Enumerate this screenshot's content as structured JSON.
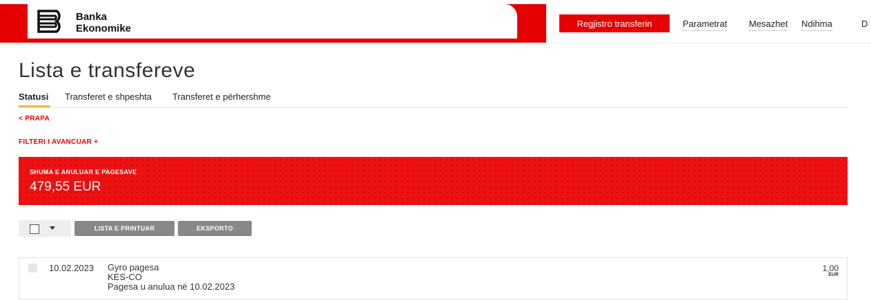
{
  "brand": {
    "line1": "Banka",
    "line2": "Ekonomike",
    "accent": "#e60000"
  },
  "header": {
    "register_label": "Regjistro transferin",
    "nav": [
      "Parametrat",
      "Mesazhet",
      "Ndihma",
      "D"
    ]
  },
  "page": {
    "title": "Lista e transfereve",
    "tabs": [
      "Statusi",
      "Transferet e shpeshta",
      "Transferet e përhershme"
    ],
    "active_tab": "Statusi",
    "back_label": "< PRAPA",
    "filter_label": "FILTERI I AVANCUAR +"
  },
  "summary": {
    "label": "SHUMA E ANULUAR E PAGESAVE",
    "amount": "479,55 EUR"
  },
  "toolbar": {
    "print_label": "LISTA E PRINTUAR",
    "export_label": "EKSPORTO"
  },
  "transfers": [
    {
      "date": "10.02.2023",
      "type": "Gyro pagesa",
      "payee": "KES-CO",
      "status": "Pagesa u anulua në 10.02.2023",
      "amount": "1,00",
      "currency": "EUR"
    }
  ]
}
